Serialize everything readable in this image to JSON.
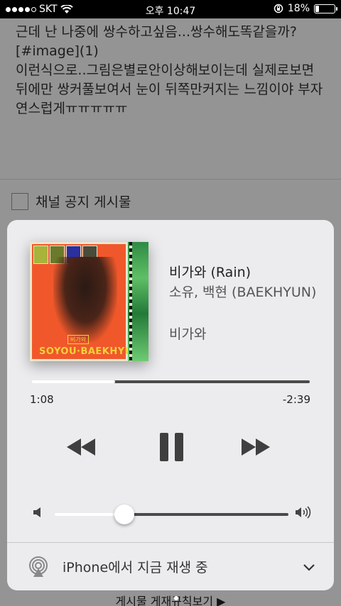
{
  "status_bar": {
    "carrier": "SKT",
    "time": "오후 10:47",
    "battery": "18%"
  },
  "background": {
    "post_lines": [
      "근데 난 나중에 쌍수하고싶음...쌍수해도똑같을까?",
      "[#image](1)",
      "이런식으로..그림은별로안이상해보이는데 실제로보면",
      "뒤에만 쌍커풀보여서 눈이 뒤쪽만커지는 느낌이야 부자",
      "연스럽게ㅠㅠㅠㅠㅠ"
    ],
    "notice_label": "채널 공지 게시물",
    "rules_link": "게시물 게재규칙보기 ▶"
  },
  "now_playing": {
    "title": "비가와 (Rain)",
    "artist": "소유, 백현 (BAEKHYUN)",
    "album": "비가와",
    "artwork_text": "SOYOU·BAEKHYUN",
    "artwork_small_text": "비가와",
    "elapsed": "1:08",
    "remaining": "-2:39",
    "progress": 0.3,
    "volume": 0.3
  },
  "airplay": {
    "label": "iPhone에서 지금 재생 중"
  },
  "icons": {
    "rewind": "rewind-icon",
    "pause": "pause-icon",
    "fast_forward": "fast-forward-icon",
    "volume_low": "volume-low-icon",
    "volume_high": "volume-high-icon",
    "airplay": "airplay-icon",
    "chevron": "chevron-down-icon"
  }
}
